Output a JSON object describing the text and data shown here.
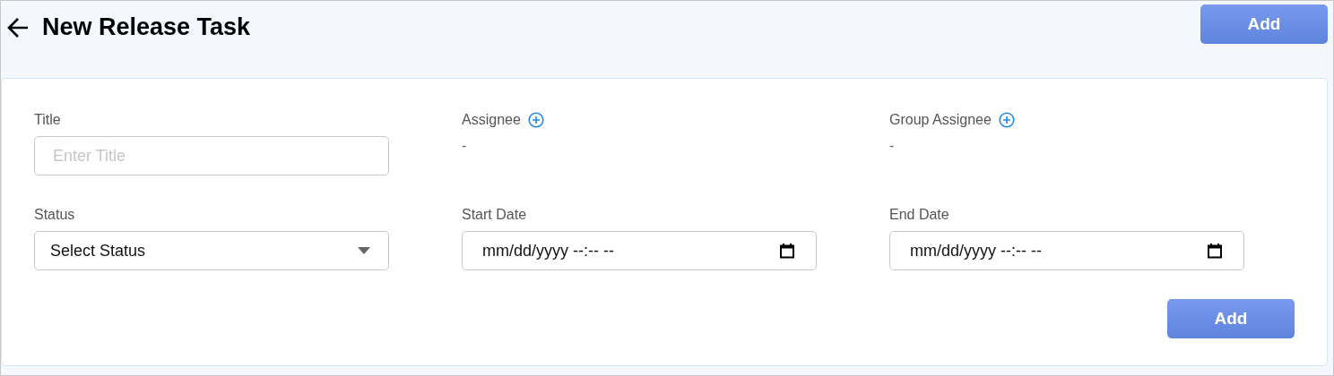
{
  "header": {
    "title": "New Release Task",
    "button": "Add"
  },
  "fields": [
    {
      "kind": "text",
      "label": "Title",
      "placeholder": "Enter Title"
    },
    {
      "kind": "assignee",
      "label": "Assignee",
      "value": "-"
    },
    {
      "kind": "assignee",
      "label": "Group Assignee",
      "value": "-"
    },
    {
      "kind": "select",
      "label": "Status",
      "value": "Select Status"
    },
    {
      "kind": "datetime",
      "label": "Start Date",
      "value": "mm/dd/yyyy --:-- --"
    },
    {
      "kind": "datetime",
      "label": "End Date",
      "value": "mm/dd/yyyy --:-- --"
    }
  ],
  "submit": "Add"
}
